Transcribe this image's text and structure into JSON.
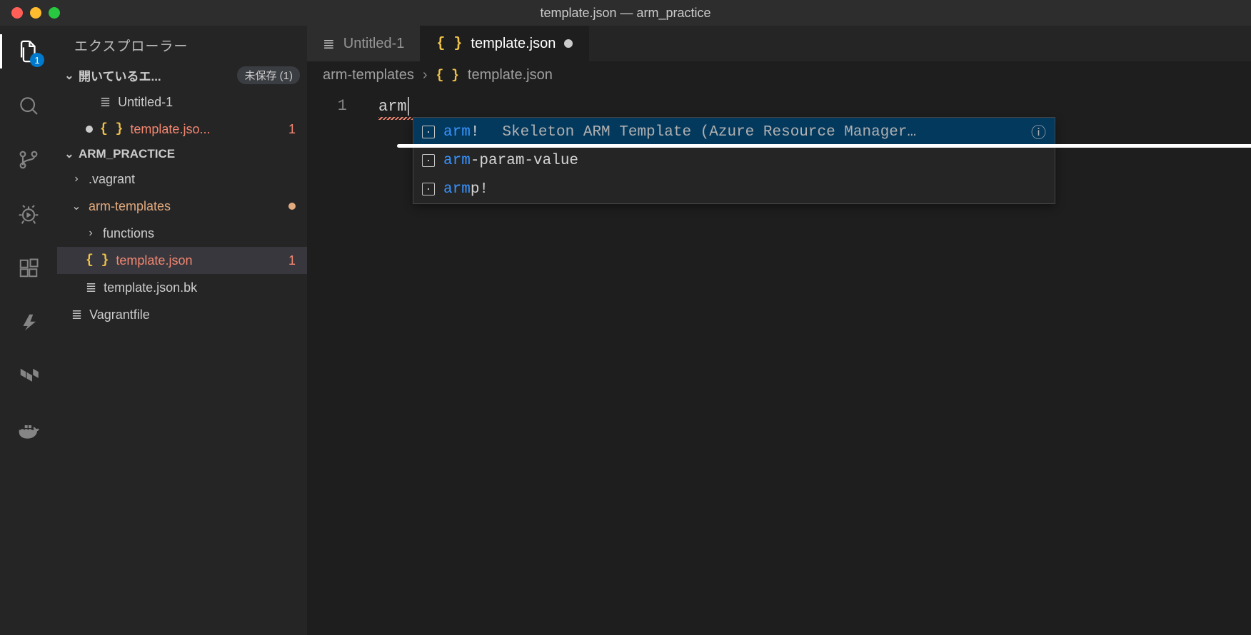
{
  "window": {
    "title": "template.json — arm_practice"
  },
  "activity": {
    "badge": "1"
  },
  "explorer": {
    "title": "エクスプローラー",
    "openEditors": {
      "label": "開いているエ...",
      "unsaved": "未保存 (1)"
    },
    "openFiles": [
      {
        "name": "Untitled-1",
        "dirty": false,
        "error": false
      },
      {
        "name": "template.jso...",
        "dirty": true,
        "error": true,
        "errCount": "1"
      }
    ],
    "project": "ARM_PRACTICE",
    "tree": [
      {
        "name": ".vagrant",
        "type": "folder",
        "expanded": false,
        "indent": 0
      },
      {
        "name": "arm-templates",
        "type": "folder",
        "expanded": true,
        "indent": 0,
        "modified": true
      },
      {
        "name": "functions",
        "type": "folder",
        "expanded": false,
        "indent": 1
      },
      {
        "name": "template.json",
        "type": "json",
        "indent": 1,
        "error": true,
        "errCount": "1",
        "selected": true
      },
      {
        "name": "template.json.bk",
        "type": "file",
        "indent": 1
      },
      {
        "name": "Vagrantfile",
        "type": "file",
        "indent": 0
      }
    ]
  },
  "tabs": [
    {
      "label": "Untitled-1",
      "icon": "lines",
      "active": false,
      "dirty": false
    },
    {
      "label": "template.json",
      "icon": "braces",
      "active": true,
      "dirty": true
    }
  ],
  "breadcrumbs": {
    "folder": "arm-templates",
    "file": "template.json"
  },
  "editor": {
    "lineNum": "1",
    "typed": "arm"
  },
  "suggestions": [
    {
      "match": "arm",
      "rest": "!",
      "desc": "Skeleton ARM Template (Azure Resource Manager…",
      "selected": true,
      "info": true
    },
    {
      "match": "arm",
      "rest": "-param-value",
      "desc": "",
      "selected": false
    },
    {
      "match": "arm",
      "rest": "p!",
      "desc": "",
      "selected": false
    }
  ]
}
